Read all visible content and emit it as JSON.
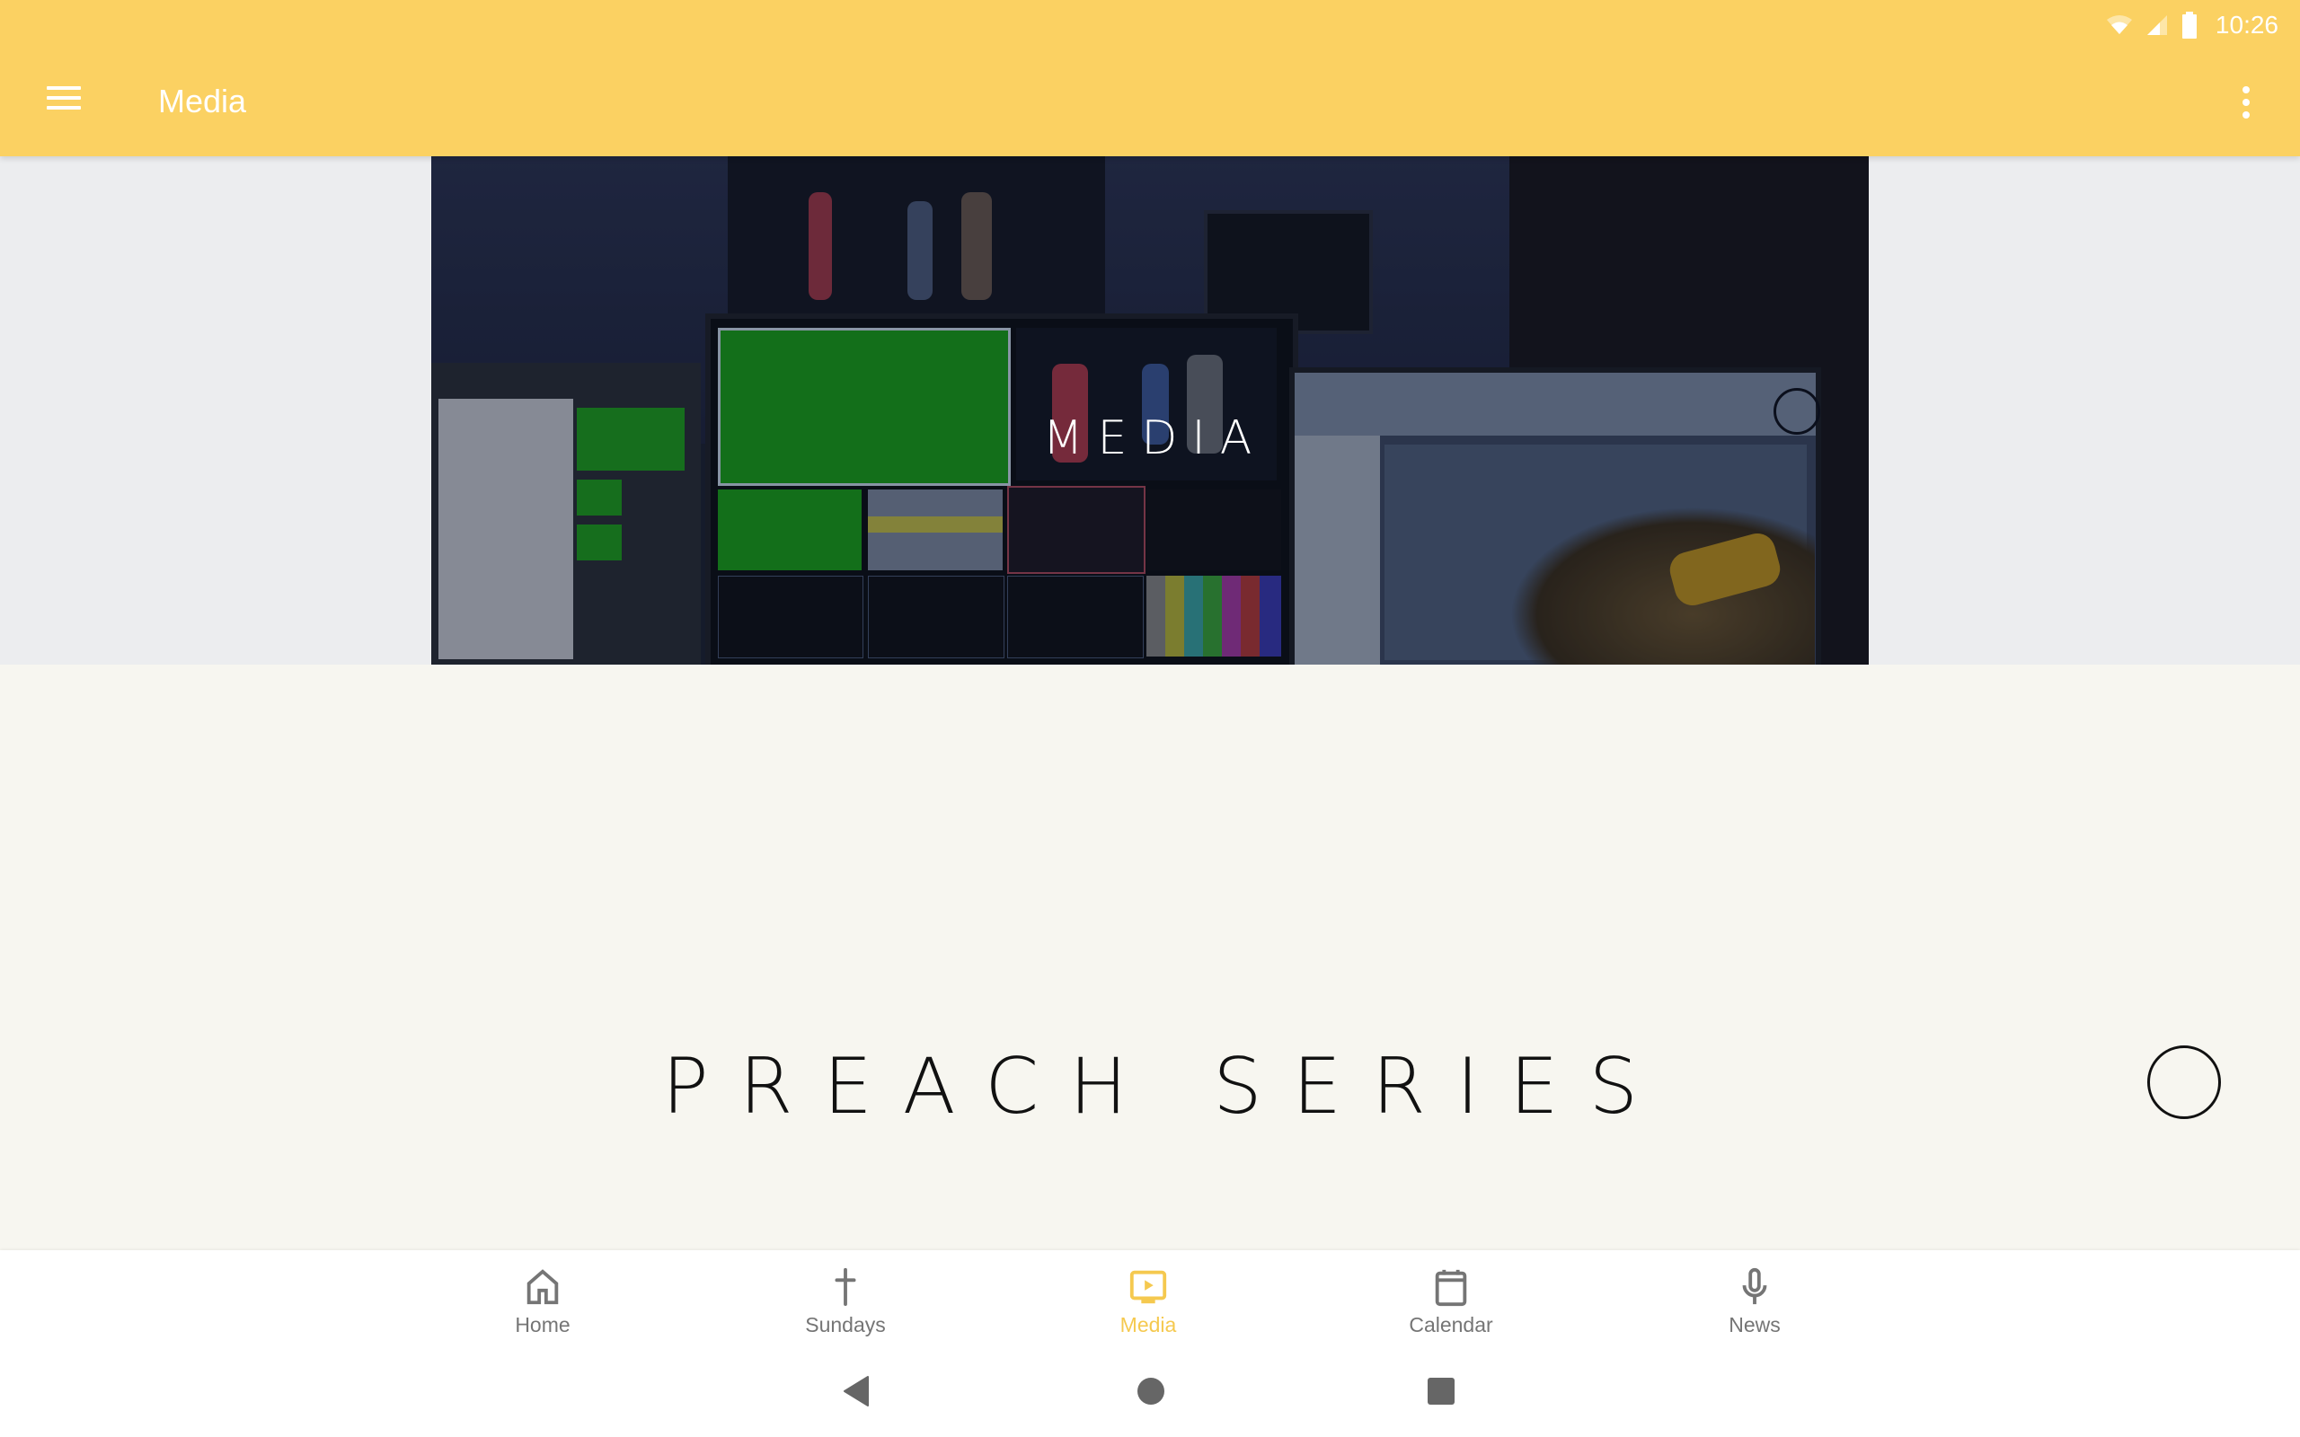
{
  "status_bar": {
    "time": "10:26",
    "icons": [
      "wifi-icon",
      "cell-signal-icon",
      "battery-icon"
    ]
  },
  "app_bar": {
    "title": "Media",
    "menu_icon": "hamburger-menu-icon",
    "more_icon": "more-vert-icon",
    "background_color": "#fbd162"
  },
  "hero": {
    "title": "MEDIA",
    "image_description": "Church media booth with video switcher monitors"
  },
  "series": {
    "title": "PREACH SERIES"
  },
  "bottom_nav": {
    "active_color": "#f5c94f",
    "inactive_color": "#757575",
    "items": [
      {
        "label": "Home",
        "icon": "home-icon",
        "active": false
      },
      {
        "label": "Sundays",
        "icon": "cross-icon",
        "active": false
      },
      {
        "label": "Media",
        "icon": "media-play-icon",
        "active": true
      },
      {
        "label": "Calendar",
        "icon": "calendar-icon",
        "active": false
      },
      {
        "label": "News",
        "icon": "microphone-icon",
        "active": false
      }
    ]
  },
  "system_nav": {
    "buttons": [
      "back",
      "home",
      "recents"
    ]
  }
}
